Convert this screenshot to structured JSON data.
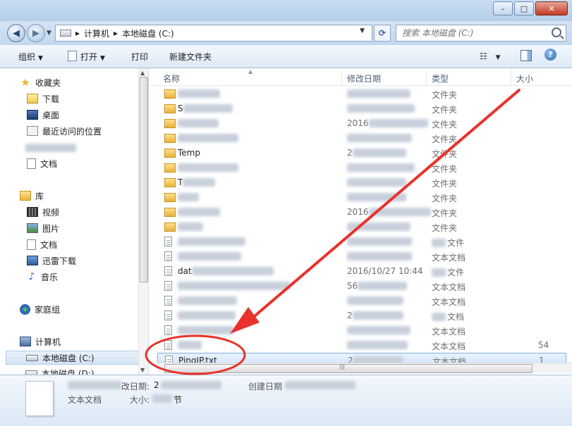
{
  "window": {
    "minimize_glyph": "–",
    "maximize_glyph": "□",
    "close_glyph": "✕"
  },
  "address": {
    "back_glyph": "◀",
    "forward_glyph": "▶",
    "crumb_sep": "▸",
    "crumbs": [
      "计算机",
      "本地磁盘 (C:)"
    ],
    "refresh_glyph": "⟳"
  },
  "search": {
    "placeholder": "搜索 本地磁盘 (C:)"
  },
  "toolbar": {
    "organize": "组织",
    "open": "打开",
    "print": "打印",
    "new_folder": "新建文件夹",
    "caret": "▼",
    "view_glyph": "☷",
    "help_glyph": "?"
  },
  "nav": {
    "favorites": "收藏夹",
    "downloads": "下载",
    "desktop": "桌面",
    "recent": "最近访问的位置",
    "documents_fav": "文档",
    "libraries": "库",
    "videos": "视频",
    "pictures": "图片",
    "documents": "文档",
    "xunlei": "迅雷下载",
    "music": "音乐",
    "homegroup": "家庭组",
    "computer": "计算机",
    "local_c": "本地磁盘 (C:)",
    "local_d": "本地磁盘 (D:)"
  },
  "columns": {
    "name": "名称",
    "date": "修改日期",
    "type": "类型",
    "size": "大小"
  },
  "files": [
    {
      "name": "",
      "date": "",
      "type": "文件夹",
      "size": ""
    },
    {
      "name": "S",
      "date": "",
      "type": "文件夹",
      "size": ""
    },
    {
      "name": "",
      "date": "2016",
      "type": "文件夹",
      "size": ""
    },
    {
      "name": "",
      "date": "",
      "type": "文件夹",
      "size": ""
    },
    {
      "name": "Temp",
      "date": "2",
      "type": "文件夹",
      "size": ""
    },
    {
      "name": "",
      "date": "",
      "type": "文件夹",
      "size": ""
    },
    {
      "name": "T",
      "date": "",
      "type": "文件夹",
      "size": ""
    },
    {
      "name": "",
      "date": "",
      "type": "文件夹",
      "size": ""
    },
    {
      "name": "",
      "date": "2016",
      "type": "文件夹",
      "size": ""
    },
    {
      "name": "",
      "date": "",
      "type": "文件夹",
      "size": ""
    },
    {
      "name": "",
      "date": "",
      "type": "文件",
      "size": ""
    },
    {
      "name": "",
      "date": "",
      "type": "文本文档",
      "size": ""
    },
    {
      "name": "dat",
      "date": "2016/10/27 10:44",
      "type": "文件",
      "size": ""
    },
    {
      "name": "",
      "date": "56",
      "type": "文本文档",
      "size": ""
    },
    {
      "name": "",
      "date": "",
      "type": "文本文档",
      "size": ""
    },
    {
      "name": "",
      "date": "2",
      "type": "文档",
      "size": ""
    },
    {
      "name": "",
      "date": "",
      "type": "文本文档",
      "size": ""
    },
    {
      "name": "",
      "date": "",
      "type": "文本文档",
      "size": "54"
    },
    {
      "name": "PingIP.txt",
      "date": "2",
      "type": "文本文档",
      "size": "1"
    }
  ],
  "details": {
    "modified_label": "改日期:",
    "modified_value": "2",
    "created_label": "创建日期",
    "type_value": "文本文档",
    "size_label": "大小:",
    "size_value": "节"
  },
  "colors": {
    "arrow": "#e8322b"
  }
}
